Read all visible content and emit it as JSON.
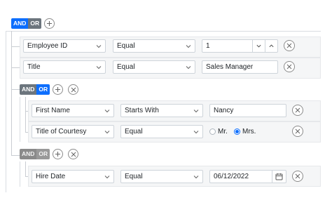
{
  "root_group": {
    "toggle": {
      "and_label": "AND",
      "or_label": "OR",
      "active": "AND"
    },
    "rules": [
      {
        "field": "Employee ID",
        "operator": "Equal",
        "value": "1"
      },
      {
        "field": "Title",
        "operator": "Equal",
        "value": "Sales Manager"
      }
    ]
  },
  "group_1": {
    "toggle": {
      "and_label": "AND",
      "or_label": "OR",
      "active": "OR"
    },
    "rules": [
      {
        "field": "First Name",
        "operator": "Starts With",
        "value": "Nancy"
      },
      {
        "field": "Title of Courtesy",
        "operator": "Equal",
        "options": [
          "Mr.",
          "Mrs."
        ],
        "selected": "Mrs."
      }
    ]
  },
  "group_2": {
    "toggle": {
      "and_label": "AND",
      "or_label": "OR",
      "active": "AND",
      "disabled": true
    },
    "rules": [
      {
        "field": "Hire Date",
        "operator": "Equal",
        "value": "06/12/2022"
      }
    ]
  },
  "colors": {
    "accent": "#0d6efd",
    "toggle_inactive": "#6c757d",
    "toggle_disabled": "#999999",
    "rule_bg": "#f5f6f7",
    "border": "#ced4da"
  },
  "icons": [
    "plus-icon",
    "close-icon",
    "chevron-down-icon",
    "chevron-up-icon",
    "calendar-icon"
  ]
}
